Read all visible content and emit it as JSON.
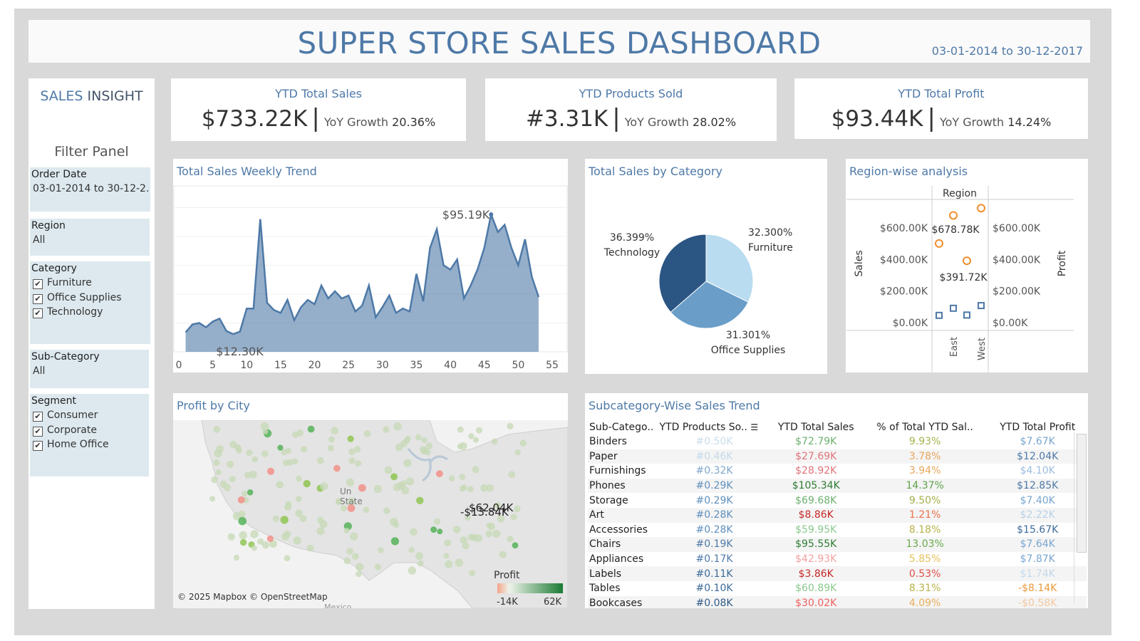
{
  "header": {
    "title": "SUPER STORE SALES DASHBOARD",
    "date_range": "03-01-2014 to 30-12-2017"
  },
  "sidebar": {
    "brand_part1": "SALES",
    "brand_part2": "INSIGHT",
    "filter_title": "Filter Panel",
    "order_date": {
      "label": "Order Date",
      "value": "03-01-2014 to 30-12-2.."
    },
    "region": {
      "label": "Region",
      "value": "All"
    },
    "category": {
      "label": "Category",
      "items": [
        "Furniture",
        "Office Supplies",
        "Technology"
      ]
    },
    "sub_category": {
      "label": "Sub-Category",
      "value": "All"
    },
    "segment": {
      "label": "Segment",
      "items": [
        "Consumer",
        "Corporate",
        "Home Office"
      ]
    },
    "check_mark": "✔"
  },
  "kpis": [
    {
      "title": "YTD Total Sales",
      "value": "$733.22K",
      "yoy_label": "YoY Growth",
      "yoy_value": "20.36%"
    },
    {
      "title": "YTD Products Sold",
      "value": "#3.31K",
      "yoy_label": "YoY Growth",
      "yoy_value": "28.02%"
    },
    {
      "title": "YTD Total Profit",
      "value": "$93.44K",
      "yoy_label": "YoY Growth",
      "yoy_value": "14.24%"
    }
  ],
  "weekly_trend": {
    "title": "Total Sales Weekly Trend",
    "max_label": "$95.19K",
    "min_label": "$12.30K"
  },
  "category_pie": {
    "title": "Total Sales by Category"
  },
  "region_panel": {
    "title": "Region-wise analysis",
    "header": "Region",
    "left_axis_title": "Sales",
    "right_axis_title": "Profit",
    "label_high": "$678.78K",
    "label_low": "$391.72K",
    "x_labels": [
      "East",
      "West"
    ]
  },
  "map_panel": {
    "title": "Profit by City",
    "attribution": "© 2025 Mapbox © OpenStreetMap",
    "legend_title": "Profit",
    "legend_min": "-14K",
    "legend_max": "62K",
    "label_max": "$62.04K",
    "label_min": "-$13.84K",
    "country_label_1": "Un",
    "country_label_2": "State",
    "mexico_label": "Mexico"
  },
  "subcat_panel": {
    "title": "Subcategory-Wise Sales Trend",
    "columns": [
      "Sub-Catego..",
      "YTD Products So..",
      "YTD Total Sales",
      "% of Total YTD Sal..",
      "YTD Total Profit"
    ],
    "rows": [
      {
        "name": "Binders",
        "qty": "#0.50K",
        "sales": "$72.79K",
        "pct": "9.93%",
        "profit": "$7.67K",
        "c_qty": "#c9dcea",
        "c_sales": "#6bb06e",
        "c_pct": "#a6b04a",
        "c_profit": "#7aa6cf"
      },
      {
        "name": "Paper",
        "qty": "#0.46K",
        "sales": "$27.69K",
        "pct": "3.78%",
        "profit": "$12.04K",
        "c_qty": "#c4d8e8",
        "c_sales": "#e0737a",
        "c_pct": "#e8a55a",
        "c_profit": "#4e79a7"
      },
      {
        "name": "Furnishings",
        "qty": "#0.32K",
        "sales": "$28.92K",
        "pct": "3.94%",
        "profit": "$4.10K",
        "c_qty": "#7ea6cc",
        "c_sales": "#e0737a",
        "c_pct": "#e8a55a",
        "c_profit": "#9dbde0"
      },
      {
        "name": "Phones",
        "qty": "#0.29K",
        "sales": "$105.34K",
        "pct": "14.37%",
        "profit": "$12.85K",
        "c_qty": "#5f8fbd",
        "c_sales": "#2e7d32",
        "c_pct": "#5da34a",
        "c_profit": "#4e79a7"
      },
      {
        "name": "Storage",
        "qty": "#0.29K",
        "sales": "$69.68K",
        "pct": "9.50%",
        "profit": "$7.40K",
        "c_qty": "#5f8fbd",
        "c_sales": "#6bb06e",
        "c_pct": "#a6b04a",
        "c_profit": "#7aa6cf"
      },
      {
        "name": "Art",
        "qty": "#0.28K",
        "sales": "$8.86K",
        "pct": "1.21%",
        "profit": "$2.22K",
        "c_qty": "#5f8fbd",
        "c_sales": "#c62828",
        "c_pct": "#e8724a",
        "c_profit": "#b7d0e8"
      },
      {
        "name": "Accessories",
        "qty": "#0.28K",
        "sales": "$59.95K",
        "pct": "8.18%",
        "profit": "$15.67K",
        "c_qty": "#5f8fbd",
        "c_sales": "#8bc88d",
        "c_pct": "#b8b24a",
        "c_profit": "#3c6a99"
      },
      {
        "name": "Chairs",
        "qty": "#0.19K",
        "sales": "$95.55K",
        "pct": "13.03%",
        "profit": "$7.64K",
        "c_qty": "#4e79a7",
        "c_sales": "#2e7d32",
        "c_pct": "#6aa84a",
        "c_profit": "#7aa6cf"
      },
      {
        "name": "Appliances",
        "qty": "#0.17K",
        "sales": "$42.93K",
        "pct": "5.85%",
        "profit": "$7.87K",
        "c_qty": "#4e79a7",
        "c_sales": "#f4a0a0",
        "c_pct": "#e8c05a",
        "c_profit": "#7aa6cf"
      },
      {
        "name": "Labels",
        "qty": "#0.11K",
        "sales": "$3.86K",
        "pct": "0.53%",
        "profit": "$1.74K",
        "c_qty": "#3c6a99",
        "c_sales": "#c62828",
        "c_pct": "#e0504a",
        "c_profit": "#c4d8e8"
      },
      {
        "name": "Tables",
        "qty": "#0.10K",
        "sales": "$60.89K",
        "pct": "8.31%",
        "profit": "-$8.14K",
        "c_qty": "#3c6a99",
        "c_sales": "#8bc88d",
        "c_pct": "#b8b24a",
        "c_profit": "#e89a3a"
      },
      {
        "name": "Bookcases",
        "qty": "#0.08K",
        "sales": "$30.02K",
        "pct": "4.09%",
        "profit": "-$0.58K",
        "c_qty": "#2f5b86",
        "c_sales": "#f06060",
        "c_pct": "#e8b05a",
        "c_profit": "#f4c8a0"
      }
    ]
  },
  "chart_data": [
    {
      "type": "area",
      "title": "Total Sales Weekly Trend",
      "xlim": [
        0,
        55
      ],
      "x_ticks": [
        0,
        5,
        10,
        15,
        20,
        25,
        30,
        35,
        40,
        45,
        50,
        55
      ],
      "ylim": [
        0,
        115
      ],
      "x": [
        1,
        2,
        3,
        4,
        5,
        6,
        7,
        8,
        9,
        10,
        11,
        12,
        13,
        14,
        15,
        16,
        17,
        18,
        19,
        20,
        21,
        22,
        23,
        24,
        25,
        26,
        27,
        28,
        29,
        30,
        31,
        32,
        33,
        34,
        35,
        36,
        37,
        38,
        39,
        40,
        41,
        42,
        43,
        44,
        45,
        46,
        47,
        48,
        49,
        50,
        51,
        52,
        53
      ],
      "values": [
        13.5,
        19,
        20,
        17,
        21,
        23,
        14.5,
        12.3,
        14,
        30,
        30,
        92,
        34,
        29,
        27,
        36,
        22,
        31,
        36,
        33,
        46,
        37,
        42,
        37,
        39,
        28,
        32,
        46,
        24,
        31,
        39,
        27,
        30,
        28,
        54,
        35,
        72,
        85,
        60,
        57,
        64,
        37,
        46,
        57,
        72,
        95.19,
        83,
        88,
        72,
        60,
        78,
        52,
        38
      ],
      "color": "#4e79a7"
    },
    {
      "type": "pie",
      "title": "Total Sales by Category",
      "labels": [
        "Furniture",
        "Office Supplies",
        "Technology"
      ],
      "values": [
        32.3,
        31.301,
        36.399
      ],
      "value_labels": [
        "32.300%",
        "31.301%",
        "36.399%"
      ],
      "colors": [
        "#b9dcf0",
        "#6a9ec9",
        "#2b5583"
      ]
    },
    {
      "type": "scatter",
      "title": "Region-wise analysis",
      "categories": [
        "East",
        "West"
      ],
      "ylabel_left": "Sales",
      "ylabel_right": "Profit",
      "y_ticks": [
        "$0.00K",
        "$200.00K",
        "$400.00K",
        "$600.00K"
      ],
      "y_values": [
        0,
        200,
        400,
        600
      ],
      "ylim": [
        0,
        780
      ],
      "series": [
        {
          "marker": "circle",
          "color": "#f28e2b",
          "points": [
            {
              "region": "East",
              "slot": 0,
              "value": 501
            },
            {
              "region": "East",
              "slot": 1,
              "value": 678.78
            },
            {
              "region": "West",
              "slot": 0,
              "value": 391.72
            },
            {
              "region": "West",
              "slot": 1,
              "value": 725
            }
          ]
        },
        {
          "marker": "square",
          "color": "#4e79a7",
          "points": [
            {
              "region": "East",
              "slot": 0,
              "value": 46
            },
            {
              "region": "East",
              "slot": 1,
              "value": 91
            },
            {
              "region": "West",
              "slot": 0,
              "value": 48
            },
            {
              "region": "West",
              "slot": 1,
              "value": 108
            }
          ]
        }
      ]
    }
  ]
}
